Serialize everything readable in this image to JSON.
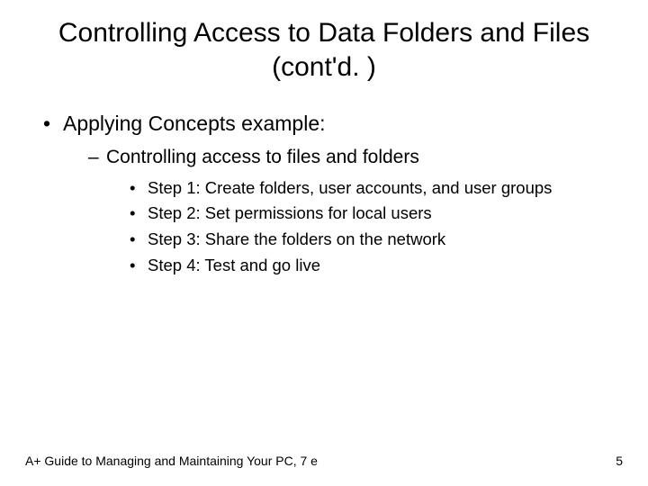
{
  "title": "Controlling Access to Data Folders and Files (cont'd. )",
  "bullets": {
    "l1": "Applying Concepts example:",
    "l2": "Controlling access to files and folders",
    "steps": [
      "Step 1: Create folders, user accounts, and user groups",
      "Step 2: Set permissions for local users",
      "Step 3: Share the folders on the network",
      "Step 4: Test and go live"
    ]
  },
  "footer": {
    "left": "A+ Guide to Managing and Maintaining Your PC, 7 e",
    "right": "5"
  }
}
